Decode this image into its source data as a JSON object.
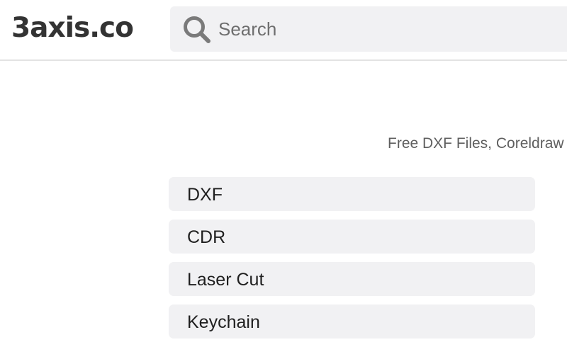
{
  "header": {
    "logo": "3axis.co",
    "search": {
      "placeholder": "Search",
      "icon": "search-icon"
    }
  },
  "main": {
    "tagline": "Free DXF Files, Coreldraw",
    "categories": [
      {
        "label": "DXF"
      },
      {
        "label": "CDR"
      },
      {
        "label": "Laser Cut"
      },
      {
        "label": "Keychain"
      }
    ]
  },
  "colors": {
    "search_bg": "#f1f1f3",
    "category_bg": "#f1f1f3",
    "logo": "#333333",
    "tagline": "#5f5f5f"
  }
}
